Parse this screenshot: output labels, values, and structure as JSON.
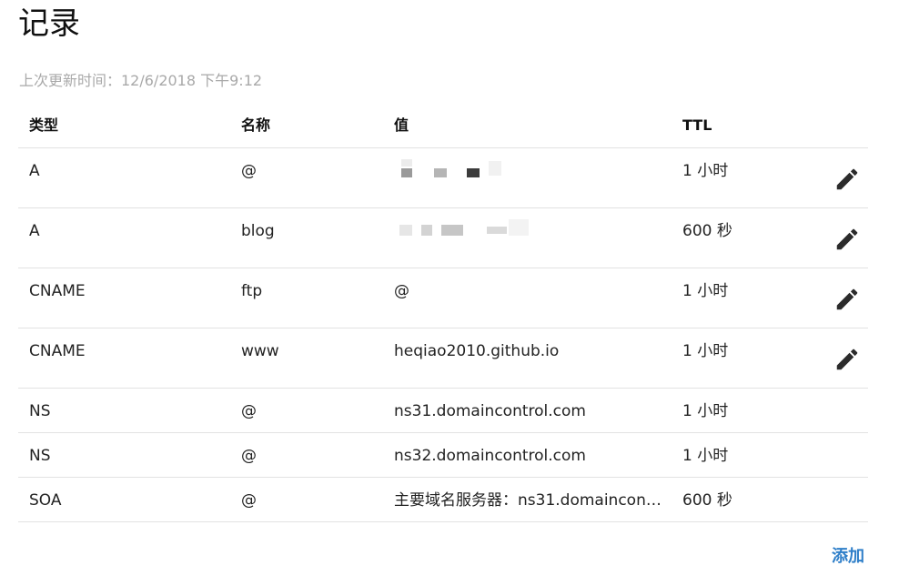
{
  "page": {
    "title": "记录",
    "updated": "上次更新时间：12/6/2018 下午9:12"
  },
  "table": {
    "headers": {
      "type": "类型",
      "name": "名称",
      "value": "值",
      "ttl": "TTL"
    },
    "rows": [
      {
        "type": "A",
        "name": "@",
        "value": "",
        "ttl": "1 小时",
        "editable": true
      },
      {
        "type": "A",
        "name": "blog",
        "value": "",
        "ttl": "600 秒",
        "editable": true
      },
      {
        "type": "CNAME",
        "name": "ftp",
        "value": "@",
        "ttl": "1 小时",
        "editable": true
      },
      {
        "type": "CNAME",
        "name": "www",
        "value": "heqiao2010.github.io",
        "ttl": "1 小时",
        "editable": true
      },
      {
        "type": "NS",
        "name": "@",
        "value": "ns31.domaincontrol.com",
        "ttl": "1 小时",
        "editable": false
      },
      {
        "type": "NS",
        "name": "@",
        "value": "ns32.domaincontrol.com",
        "ttl": "1 小时",
        "editable": false
      },
      {
        "type": "SOA",
        "name": "@",
        "value": "主要域名服务器：ns31.domaincon…",
        "ttl": "600 秒",
        "editable": false
      }
    ]
  },
  "actions": {
    "add_label": "添加"
  },
  "colors": {
    "accent": "#2f7fc9",
    "muted": "#a9a9a9",
    "divider": "#e2e2e2"
  },
  "icons": {
    "edit": "pencil-icon"
  }
}
